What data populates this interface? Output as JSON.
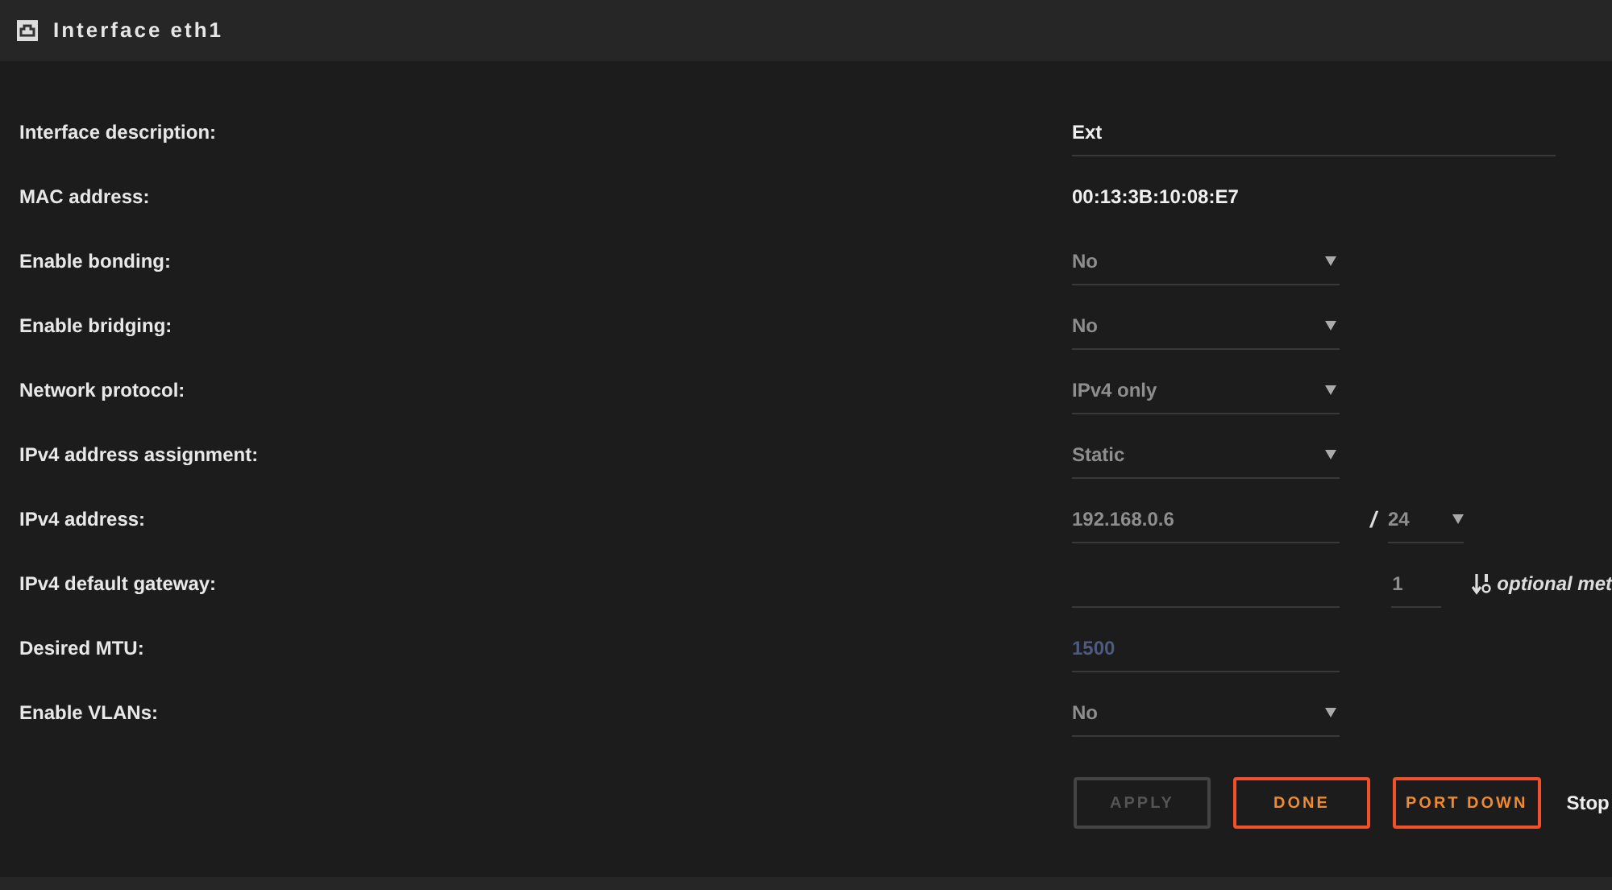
{
  "panel": {
    "title": "Interface eth1"
  },
  "rows": [
    {
      "kind": "text",
      "label": "Interface description:",
      "value": "Ext"
    },
    {
      "kind": "static",
      "label": "MAC address:",
      "value": "00:13:3B:10:08:E7"
    },
    {
      "kind": "select",
      "label": "Enable bonding:",
      "value": "No"
    },
    {
      "kind": "select",
      "label": "Enable bridging:",
      "value": "No"
    },
    {
      "kind": "select",
      "label": "Network protocol:",
      "value": "IPv4 only"
    },
    {
      "kind": "select",
      "label": "IPv4 address assignment:",
      "value": "Static"
    },
    {
      "kind": "address",
      "label": "IPv4 address:",
      "value": "192.168.0.6",
      "separator": "/",
      "prefix": "24"
    },
    {
      "kind": "gateway",
      "label": "IPv4 default gateway:",
      "metric": "1",
      "hint": "optional met"
    },
    {
      "kind": "input",
      "label": "Desired MTU:",
      "placeholder": "1500"
    },
    {
      "kind": "select",
      "label": "Enable VLANs:",
      "value": "No"
    }
  ],
  "buttons": [
    {
      "label": "APPLY",
      "disabled": true
    },
    {
      "label": "DONE",
      "disabled": false
    },
    {
      "label": "PORT DOWN",
      "disabled": false
    }
  ],
  "status_text": "Stop"
}
